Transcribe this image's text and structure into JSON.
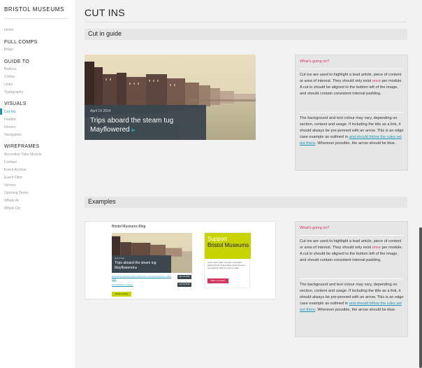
{
  "sidebar": {
    "brand": "BRISTOL MUSEUMS",
    "home": "Home",
    "sections": [
      {
        "title": "FULL COMPS",
        "items": [
          "Bingo"
        ]
      },
      {
        "title": "GUIDE TO",
        "items": [
          "Buttons",
          "Colour",
          "Links",
          "Typography"
        ]
      },
      {
        "title": "VISUALS",
        "items": [
          "Cut Ins",
          "Header",
          "Heroes",
          "Navigation"
        ]
      },
      {
        "title": "WIREFRAMES",
        "items": [
          "Accordion Tabs Module",
          "Contact",
          "Event Archive",
          "Event Filter",
          "Heroes",
          "Opening Times",
          "Whats At",
          "Whats On"
        ]
      }
    ],
    "active_item": "Cut Ins"
  },
  "main": {
    "page_title": "CUT INS",
    "guide_section": "Cut in guide",
    "examples_section": "Examples",
    "cutin": {
      "date": "April 14 2014",
      "title": "Trips aboard the steam tug Mayflowered",
      "arrow": "▶"
    },
    "info": {
      "heading": "What's going on?",
      "p1_a": "Cut ins are used to highlight a lead article, piece of content or area of interest. They should only exist ",
      "p1_red": "once",
      "p1_b": " per module. A cut in should be aligned to the bottom left of the image, and should contain consistent internal padding.",
      "p2_a": "The background and text colour may vary, depending on section, content and usage. If including the title as a link, it should always be pre-penned with an arrow. This is an edge case example as outlined in ",
      "p2_link": "and should follow the rules set out there",
      "p2_b": ". Wherever possible, the arrow should be blue."
    },
    "example": {
      "blog_title": "Bristol Museums Blog",
      "cut_date": "April 14 2014",
      "cut_title": "Trips aboard the steam tug Mayflowered ▸",
      "link1": "Recovering Historical Flight: Attractions in the Derelict Archive, 1914-1918",
      "badge1": "Nov 13 2015",
      "link2": "Free Exhibition preview?",
      "badge2": "Nov 09 2015",
      "read_more": "Read our blog",
      "support_line1": "Support",
      "support_line2": "Bristol Museums",
      "support_body": "Lorem ipsum dolor sit amet, consectetur adipiscing elit. Suspendisse, luctus et lorem sed adipiscin lobortis metus ex vitae.",
      "donate": "Make a donation"
    }
  },
  "colors": {
    "accent": "#1c96b4",
    "highlight": "#d6335e",
    "cutin_bg": "#3b464e",
    "lime": "#c8d400"
  }
}
